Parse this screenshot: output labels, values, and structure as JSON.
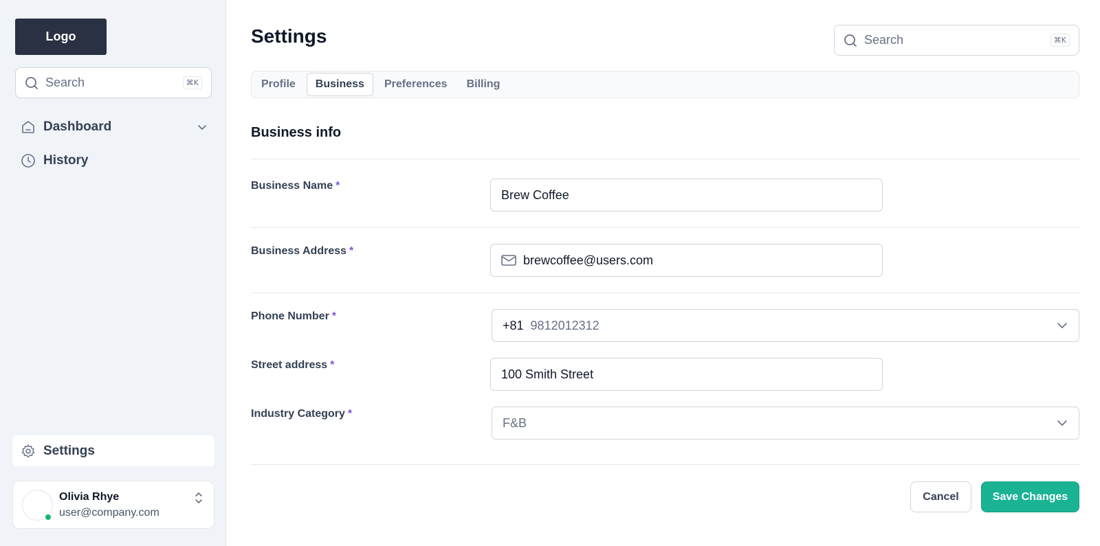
{
  "sidebar": {
    "logo": "Logo",
    "search": {
      "placeholder": "Search",
      "shortcut": "⌘K"
    },
    "nav": [
      {
        "label": "Dashboard",
        "icon": "home-icon",
        "has_dropdown": true
      },
      {
        "label": "History",
        "icon": "clock-icon"
      }
    ],
    "settings_label": "Settings",
    "user": {
      "name": "Olivia Rhye",
      "email": "user@company.com",
      "status": "online"
    }
  },
  "header": {
    "title": "Settings",
    "search": {
      "placeholder": "Search",
      "shortcut": "⌘K"
    }
  },
  "tabs": [
    {
      "label": "Profile",
      "active": false
    },
    {
      "label": "Business",
      "active": true
    },
    {
      "label": "Preferences",
      "active": false
    },
    {
      "label": "Billing",
      "active": false
    }
  ],
  "form": {
    "section_title": "Business info",
    "required_marker": "*",
    "business_name": {
      "label": "Business Name",
      "value": "Brew Coffee"
    },
    "business_address": {
      "label": "Business Address",
      "value": "brewcoffee@users.com",
      "icon": "mail-icon"
    },
    "phone": {
      "label": "Phone Number",
      "country_code": "+81",
      "value": "9812012312"
    },
    "street": {
      "label": "Street address",
      "value": "100 Smith Street"
    },
    "industry": {
      "label": "Industry Category",
      "value": "F&B"
    }
  },
  "actions": {
    "cancel": "Cancel",
    "save": "Save Changes"
  },
  "colors": {
    "accent": "#1ab394",
    "required": "#7f56d9",
    "sidebar_bg": "#f0f3f8",
    "logo_bg": "#2a3142",
    "online": "#12b76a"
  }
}
